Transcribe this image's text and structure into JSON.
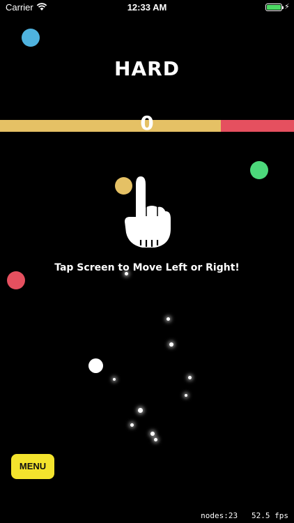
{
  "status_bar": {
    "carrier": "Carrier",
    "time": "12:33 AM"
  },
  "game": {
    "difficulty": "HARD",
    "score": "0",
    "progress": 0.75,
    "colors": {
      "blue": "#4fb3df",
      "yellow": "#e5c165",
      "red": "#e5505f",
      "green": "#4cd97b",
      "white": "#ffffff"
    }
  },
  "hint": {
    "text": "Tap Screen to Move Left or Right!",
    "icon": "pointing-hand-icon"
  },
  "menu": {
    "label": "MENU"
  },
  "debug": {
    "nodes": "nodes:23",
    "fps": "52.5 fps"
  }
}
